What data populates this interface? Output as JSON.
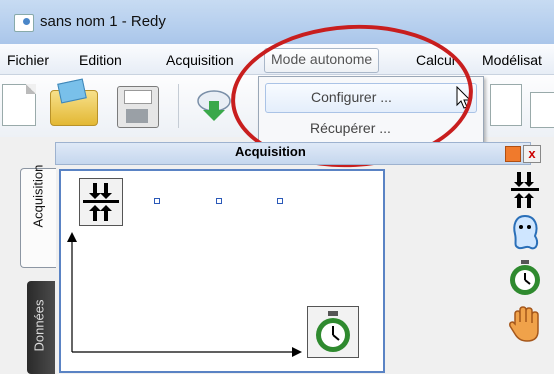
{
  "window": {
    "title": "sans nom 1 - Redy"
  },
  "menu": [
    {
      "label": "Fichier"
    },
    {
      "label": "Edition"
    },
    {
      "label": "Acquisition"
    },
    {
      "label": "Mode autonome"
    },
    {
      "label": "Calcul"
    },
    {
      "label": "Modélisat"
    }
  ],
  "dropdown": {
    "items": [
      "Configurer ...",
      "Récupérer ..."
    ]
  },
  "toolbar": {
    "icons": [
      "new-document-icon",
      "open-folder-icon",
      "save-icon",
      "download-cloud-icon"
    ]
  },
  "side_tabs": [
    "Acquisition",
    "Données"
  ],
  "panel": {
    "title": "Acquisition",
    "close_glyph": "x"
  },
  "palette": [
    "sync-icon",
    "ghost-icon",
    "timer-icon",
    "hand-icon"
  ],
  "colors": {
    "annotation": "#c81e1e",
    "selection_border": "#5a83c4"
  }
}
